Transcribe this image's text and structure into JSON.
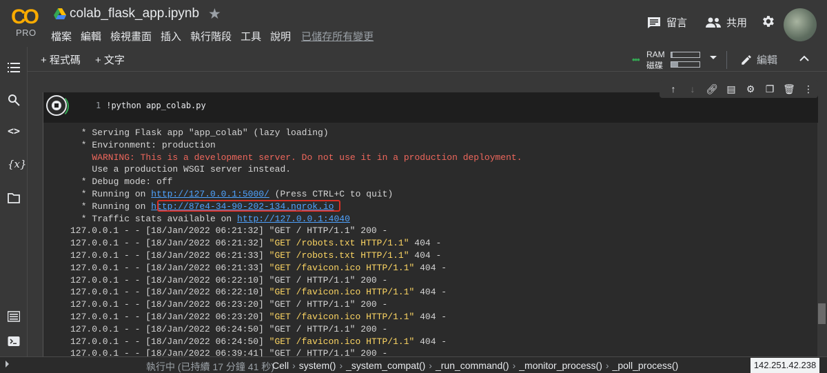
{
  "header": {
    "logo_text": "CO",
    "logo_badge": "PRO",
    "notebook_title": "colab_flask_app.ipynb",
    "menu": [
      "檔案",
      "編輯",
      "檢視畫面",
      "插入",
      "執行階段",
      "工具",
      "說明"
    ],
    "save_status": "已儲存所有變更",
    "comment_label": "留言",
    "share_label": "共用"
  },
  "toolbar": {
    "add_code": "+ 程式碼",
    "add_text": "+ 文字",
    "ram_label": "RAM",
    "disk_label": "磁碟",
    "ram_usage": 0.05,
    "disk_usage": 0.25,
    "edit_label": "編輯"
  },
  "cell": {
    "line_number": "1",
    "code": "!python  app_colab.py"
  },
  "output": {
    "line1": " * Serving Flask app \"app_colab\" (lazy loading)",
    "line2": " * Environment: production",
    "line3": "   WARNING: This is a development server. Do not use it in a production deployment.",
    "line4": "   Use a production WSGI server instead.",
    "line5": " * Debug mode: off",
    "line6_pre": " * Running on ",
    "line6_link": "http://127.0.0.1:5000/",
    "line6_post": " (Press CTRL+C to quit)",
    "line7_pre": " * Running on ",
    "line7_link": "http://87e4-34-90-202-134.ngrok.io",
    "line8_pre": " * Traffic stats available on ",
    "line8_link": "http://127.0.0.1:4040",
    "logs": [
      {
        "prefix": "127.0.0.1 - - [18/Jan/2022 06:21:32] ",
        "req": "\"GET / HTTP/1.1\"",
        "suffix": " 200 -",
        "hl": false
      },
      {
        "prefix": "127.0.0.1 - - [18/Jan/2022 06:21:32] ",
        "req": "\"GET /robots.txt HTTP/1.1\"",
        "suffix": " 404 -",
        "hl": true
      },
      {
        "prefix": "127.0.0.1 - - [18/Jan/2022 06:21:33] ",
        "req": "\"GET /robots.txt HTTP/1.1\"",
        "suffix": " 404 -",
        "hl": true
      },
      {
        "prefix": "127.0.0.1 - - [18/Jan/2022 06:21:33] ",
        "req": "\"GET /favicon.ico HTTP/1.1\"",
        "suffix": " 404 -",
        "hl": true
      },
      {
        "prefix": "127.0.0.1 - - [18/Jan/2022 06:22:10] ",
        "req": "\"GET / HTTP/1.1\"",
        "suffix": " 200 -",
        "hl": false
      },
      {
        "prefix": "127.0.0.1 - - [18/Jan/2022 06:22:10] ",
        "req": "\"GET /favicon.ico HTTP/1.1\"",
        "suffix": " 404 -",
        "hl": true
      },
      {
        "prefix": "127.0.0.1 - - [18/Jan/2022 06:23:20] ",
        "req": "\"GET / HTTP/1.1\"",
        "suffix": " 200 -",
        "hl": false
      },
      {
        "prefix": "127.0.0.1 - - [18/Jan/2022 06:23:20] ",
        "req": "\"GET /favicon.ico HTTP/1.1\"",
        "suffix": " 404 -",
        "hl": true
      },
      {
        "prefix": "127.0.0.1 - - [18/Jan/2022 06:24:50] ",
        "req": "\"GET / HTTP/1.1\"",
        "suffix": " 200 -",
        "hl": false
      },
      {
        "prefix": "127.0.0.1 - - [18/Jan/2022 06:24:50] ",
        "req": "\"GET /favicon.ico HTTP/1.1\"",
        "suffix": " 404 -",
        "hl": true
      },
      {
        "prefix": "127.0.0.1 - - [18/Jan/2022 06:39:41] ",
        "req": "\"GET / HTTP/1.1\"",
        "suffix": " 200 -",
        "hl": false
      }
    ]
  },
  "statusbar": {
    "status": "執行中 (已持續 17 分鐘 41 秒)",
    "crumbs": [
      "Cell",
      "system()",
      "_system_compat()",
      "_run_command()",
      "_monitor_process()",
      "_poll_process()"
    ],
    "ip": "142.251.42.238"
  },
  "colors": {
    "background": "#383838",
    "warning": "#ee675c",
    "link": "#4fa3ff",
    "request": "#fdd663",
    "highlight_box": "#d93025",
    "running": "#34a853"
  }
}
